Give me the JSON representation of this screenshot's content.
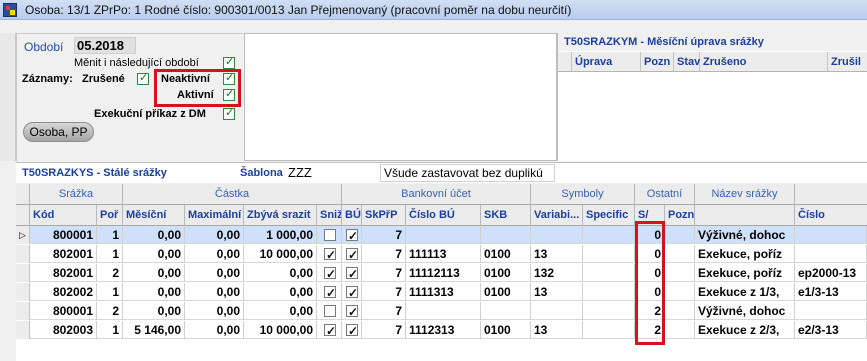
{
  "title": "Osoba: 13/1   ZPrPo: 1   Rodné číslo: 900301/0013   Jan Přejmenovaný   (pracovní poměr na dobu neurčití)",
  "panel": {
    "obdobi_label": "Období",
    "obdobi_value": "05.2018",
    "menit_label": "Měnit i následující období",
    "zaznamy_label": "Záznamy:",
    "zrusene_label": "Zrušené",
    "neaktivni_label": "Neaktivní",
    "aktivni_label": "Aktivní",
    "exekucni_label": "Exekuční příkaz z DM",
    "osoba_button": "Osoba, PP"
  },
  "right_panel": {
    "title": "T50SRAZKYM - Měsíční úprava srážky",
    "columns": [
      "",
      "Úprava",
      "Pozn",
      "Stav",
      "Zrušeno",
      "Zrušil"
    ]
  },
  "list": {
    "title": "T50SRAZKYS - Stálé srážky",
    "sablona_label": "Šablona",
    "sablona_value": "ZZZ",
    "sablona_text": "Všude zastavovat bez duplikú"
  },
  "grid": {
    "groups": [
      "Srážka",
      "Částka",
      "Bankovní účet",
      "Symboly",
      "Ostatní",
      "Název srážky"
    ],
    "columns": [
      "Kód",
      "Poř",
      "Měsíční",
      "Maximální",
      "Zbývá srazit",
      "Sniž",
      "BÚ",
      "SkPřP",
      "Číslo BÚ",
      "SKB",
      "Variabi...",
      "Specific",
      "S/",
      "Pozn",
      "",
      "Číslo"
    ],
    "rows": [
      {
        "kod": "800001",
        "por": "1",
        "mesicni": "0,00",
        "maximalni": "0,00",
        "zbyva": "1 000,00",
        "sniz": false,
        "bu": true,
        "skprp": "7",
        "cislo_bu": "",
        "skb": "",
        "var": "",
        "spec": "",
        "s": "0",
        "pozn": "",
        "nazev": "Výživné, dohoc",
        "cislo": ""
      },
      {
        "kod": "802001",
        "por": "1",
        "mesicni": "0,00",
        "maximalni": "0,00",
        "zbyva": "10 000,00",
        "sniz": true,
        "bu": true,
        "skprp": "7",
        "cislo_bu": "111113",
        "skb": "0100",
        "var": "13",
        "spec": "",
        "s": "0",
        "pozn": "",
        "nazev": "Exekuce, poříz",
        "cislo": ""
      },
      {
        "kod": "802001",
        "por": "2",
        "mesicni": "0,00",
        "maximalni": "0,00",
        "zbyva": "0,00",
        "sniz": true,
        "bu": true,
        "skprp": "7",
        "cislo_bu": "11112113",
        "skb": "0100",
        "var": "132",
        "spec": "",
        "s": "0",
        "pozn": "",
        "nazev": "Exekuce, poříz",
        "cislo": "ep2000-13"
      },
      {
        "kod": "802002",
        "por": "1",
        "mesicni": "0,00",
        "maximalni": "0,00",
        "zbyva": "0,00",
        "sniz": true,
        "bu": true,
        "skprp": "7",
        "cislo_bu": "1111313",
        "skb": "0100",
        "var": "13",
        "spec": "",
        "s": "0",
        "pozn": "",
        "nazev": "Exekuce  z 1/3,",
        "cislo": "e1/3-13"
      },
      {
        "kod": "800001",
        "por": "2",
        "mesicni": "0,00",
        "maximalni": "0,00",
        "zbyva": "0,00",
        "sniz": false,
        "bu": true,
        "skprp": "7",
        "cislo_bu": "",
        "skb": "",
        "var": "",
        "spec": "",
        "s": "2",
        "pozn": "",
        "nazev": "Výživné, dohoc",
        "cislo": ""
      },
      {
        "kod": "802003",
        "por": "1",
        "mesicni": "5 146,00",
        "maximalni": "0,00",
        "zbyva": "10 000,00",
        "sniz": true,
        "bu": true,
        "skprp": "7",
        "cislo_bu": "1112313",
        "skb": "0100",
        "var": "13",
        "spec": "",
        "s": "2",
        "pozn": "",
        "nazev": "Exekuce  z 2/3,",
        "cislo": "e2/3-13"
      }
    ]
  },
  "colors": {
    "accent": "#1a3fa0",
    "highlight": "#d3141c",
    "checkbox": "#2d8a3e"
  }
}
